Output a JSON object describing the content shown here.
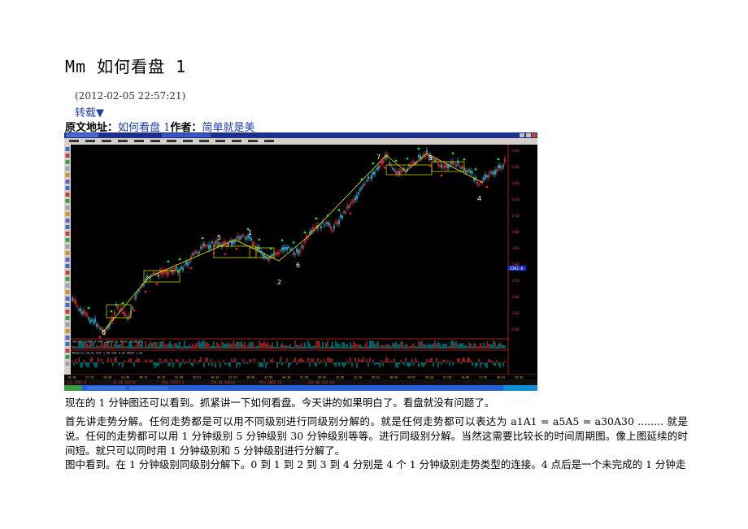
{
  "article": {
    "title": "Mm 如何看盘 1",
    "date": "(2012-02-05 22:57:21)",
    "repost_label": "转载▼",
    "source_label": "原文地址：",
    "source_title": "如何看盘 1",
    "author_label": "作者：",
    "author_name": "简单就是美"
  },
  "screenshot": {
    "wave_labels": [
      "0",
      "5",
      "1",
      "2",
      "6",
      "7",
      "3",
      "4"
    ],
    "price_axis": [
      "2450",
      "2440",
      "2430",
      "2420",
      "2410",
      "2400",
      "2390",
      "2380",
      "2370",
      "2360",
      "2350",
      "2340"
    ],
    "highlight_price": "2383.8",
    "colors": {
      "candle_up": "#ff3b3b",
      "candle_down": "#3bd6ff",
      "signal_up": "#19ff19",
      "signal_down": "#ff2a2a",
      "trend": "#e6e600"
    }
  },
  "paragraphs": {
    "p1": "现在的 1 分钟图还可以看到。抓紧讲一下如何看盘。今天讲的如果明白了。看盘就没有问题了。",
    "p2": "首先讲走势分解。任何走势都是可以用不同级别进行同级别分解的。就是任何走势都可以表达为 a1A1 = a5A5 = a30A30 ........ 就是说。任何的走势都可以用 1 分钟级别 5 分钟级别 30 分钟级别等等。进行同级别分解。当然这需要比较长的时间周期图。像上图延续的时间短。就只可以同时用 1 分钟级别和 5 分钟级别进行分解了。",
    "p3": "图中看到。在 1 分钟级别同级别分解下。0 到 1 到 2 到 3 到 4 分别是 4 个 1 分钟级别走势类型的连接。4 点后是一个未完成的 1 分钟走"
  }
}
